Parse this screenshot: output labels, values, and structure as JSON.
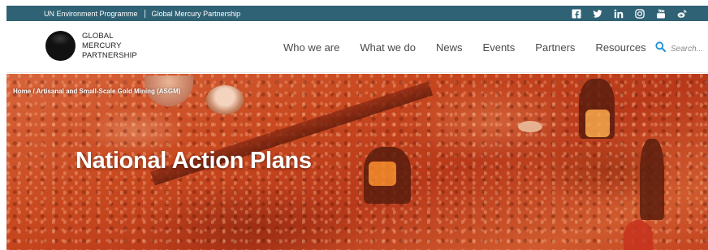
{
  "topbar": {
    "org_primary": "UN Environment Programme",
    "org_secondary": "Global Mercury Partnership",
    "socials": [
      "facebook-icon",
      "twitter-icon",
      "linkedin-icon",
      "instagram-icon",
      "youtube-icon",
      "weibo-icon"
    ],
    "bar_color": "#2f6274"
  },
  "logo": {
    "line1": "GLOBAL",
    "line2": "MERCURY",
    "line3": "PARTNERSHIP"
  },
  "nav": {
    "items": [
      {
        "label": "Who we are"
      },
      {
        "label": "What we do"
      },
      {
        "label": "News"
      },
      {
        "label": "Events"
      },
      {
        "label": "Partners"
      },
      {
        "label": "Resources"
      }
    ]
  },
  "search": {
    "placeholder": "Search...",
    "icon": "search-icon",
    "icon_color": "#1f8fd6"
  },
  "hero": {
    "breadcrumb_home": "Home",
    "breadcrumb_separator": " / ",
    "breadcrumb_section": "Artisanal and Small-Scale Gold Mining (ASGM)",
    "title": "National Action Plans"
  }
}
